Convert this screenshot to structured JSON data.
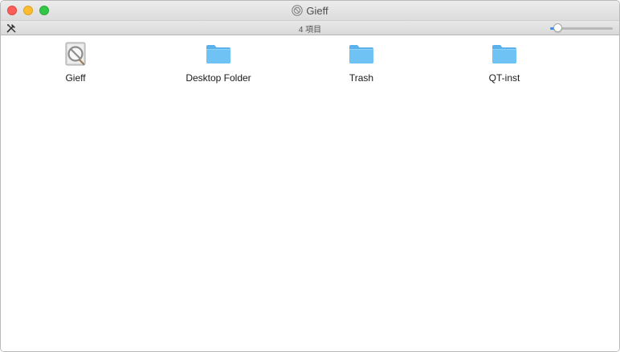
{
  "window": {
    "title": "Gieff",
    "item_count": "4 項目",
    "icon_size_slider": 0.12
  },
  "items": [
    {
      "label": "Gieff",
      "icon": "disk-image-icon"
    },
    {
      "label": "Desktop Folder",
      "icon": "folder-icon"
    },
    {
      "label": "Trash",
      "icon": "folder-icon"
    },
    {
      "label": "QT-inst",
      "icon": "folder-icon"
    }
  ],
  "colors": {
    "folder_body": "#6fc3f4",
    "folder_tab": "#5ab2ec",
    "slider_accent": "#3b8df5"
  }
}
